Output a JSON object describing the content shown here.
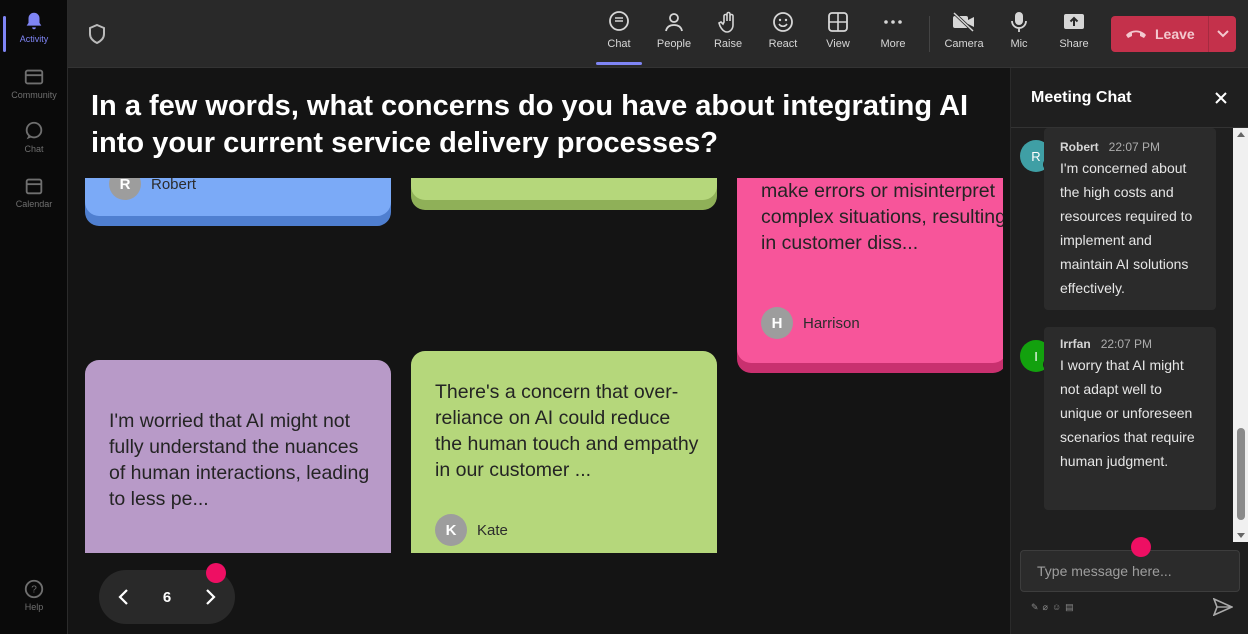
{
  "rail": {
    "items": [
      {
        "label": "Activity",
        "icon": "bell-icon"
      },
      {
        "label": "Community",
        "icon": "community-icon"
      },
      {
        "label": "Chat",
        "icon": "chat-icon"
      },
      {
        "label": "Calendar",
        "icon": "calendar-icon"
      }
    ],
    "help": "Help"
  },
  "toolbar": {
    "buttons": [
      {
        "label": "Chat",
        "icon": "chat-icon"
      },
      {
        "label": "People",
        "icon": "people-icon"
      },
      {
        "label": "Raise",
        "icon": "hand-icon"
      },
      {
        "label": "React",
        "icon": "smile-icon"
      },
      {
        "label": "View",
        "icon": "grid-icon"
      },
      {
        "label": "More",
        "icon": "more-icon"
      },
      {
        "label": "Camera",
        "icon": "camera-off-icon"
      },
      {
        "label": "Mic",
        "icon": "mic-icon"
      },
      {
        "label": "Share",
        "icon": "share-icon"
      }
    ],
    "leave_label": "Leave",
    "accent": "#7f85f5",
    "leave_color": "#c4314b"
  },
  "stage": {
    "question": "In a few words, what concerns do you have about integrating AI into your current service delivery processes?",
    "cards": [
      {
        "author": "Robert",
        "initial": "R",
        "color": "#7baaf7"
      },
      {
        "author": "",
        "initial": "",
        "color": "#b5d77b"
      },
      {
        "text": "make errors or misinterpret complex situations, resulting in customer diss...",
        "author": "Harrison",
        "initial": "H",
        "color": "#f7559a"
      },
      {
        "text": "I'm worried that AI might not fully understand the nuances of human interactions, leading to less pe...",
        "author": "",
        "initial": "",
        "color": "#b89ac8"
      },
      {
        "text": "There's a concern that over-reliance on AI could reduce the human touch and empathy in our customer ...",
        "author": "Kate",
        "initial": "K",
        "color": "#b5d77b"
      }
    ],
    "page": "6"
  },
  "chat": {
    "title": "Meeting Chat",
    "messages": [
      {
        "author": "Robert",
        "initial": "R",
        "time": "22:07 PM",
        "text": "I'm concerned about the high costs and resources required to implement and maintain AI solutions effectively.",
        "avatar_color": "#3f9fa5"
      },
      {
        "author": "Irrfan",
        "initial": "I",
        "time": "22:07 PM",
        "text": "I worry that AI might not adapt well to unique or unforeseen scenarios that require human judgment.",
        "avatar_color": "#13a10e"
      }
    ],
    "input_placeholder": "Type message here..."
  }
}
